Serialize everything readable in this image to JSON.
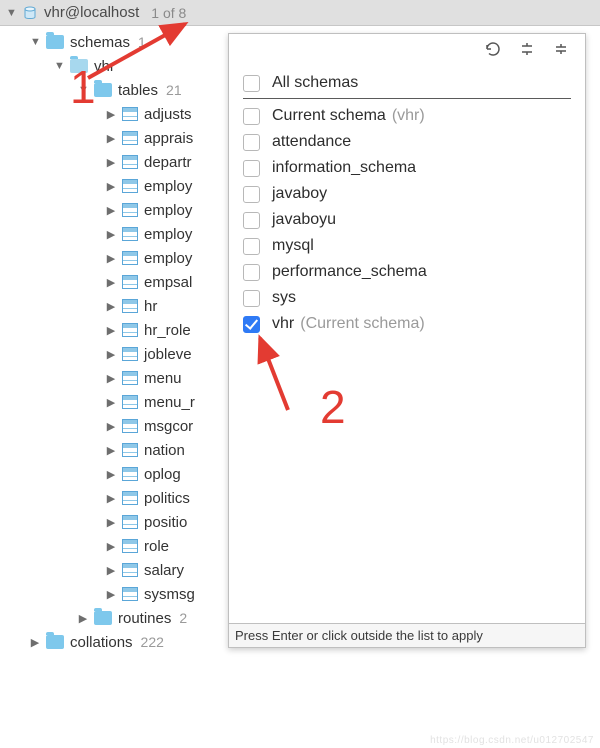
{
  "topbar": {
    "title": "vhr@localhost",
    "count": "1 of 8"
  },
  "tree": {
    "schemas_label": "schemas",
    "schemas_count": "1",
    "db_label": "vhr",
    "tables_label": "tables",
    "tables_count": "21",
    "tables": [
      "adjusts",
      "apprais",
      "departr",
      "employ",
      "employ",
      "employ",
      "employ",
      "empsal",
      "hr",
      "hr_role",
      "jobleve",
      "menu",
      "menu_r",
      "msgcor",
      "nation",
      "oplog",
      "politics",
      "positio",
      "role",
      "salary",
      "sysmsg"
    ],
    "routines_label": "routines",
    "routines_count": "2",
    "collations_label": "collations",
    "collations_count": "222"
  },
  "popup": {
    "all_label": "All schemas",
    "current_label": "Current schema",
    "current_note": "(vhr)",
    "items": [
      {
        "label": "attendance",
        "checked": false
      },
      {
        "label": "information_schema",
        "checked": false
      },
      {
        "label": "javaboy",
        "checked": false
      },
      {
        "label": "javaboyu",
        "checked": false
      },
      {
        "label": "mysql",
        "checked": false
      },
      {
        "label": "performance_schema",
        "checked": false
      },
      {
        "label": "sys",
        "checked": false
      },
      {
        "label": "vhr",
        "checked": true,
        "note": "(Current schema)"
      }
    ],
    "footer": "Press Enter or click outside the list to apply"
  },
  "annotations": {
    "num1": "1",
    "num2": "2"
  },
  "watermark": "https://blog.csdn.net/u012702547"
}
